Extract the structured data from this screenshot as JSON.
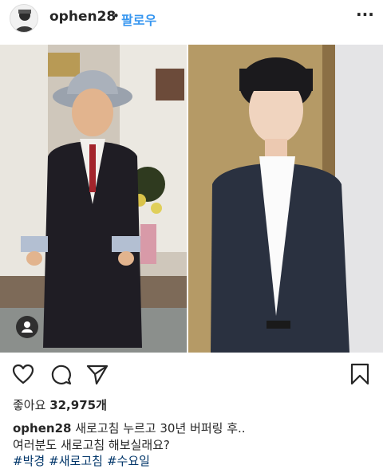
{
  "post": {
    "username": "ophen28",
    "separator": "•",
    "follow_label": "팔로우",
    "more_label": "···"
  },
  "actions": {
    "like_icon": "heart-icon",
    "comment_icon": "comment-icon",
    "share_icon": "paper-plane-icon",
    "save_icon": "bookmark-icon"
  },
  "likes": {
    "label": "좋아요",
    "count": "32,975개"
  },
  "caption": {
    "username": "ophen28",
    "line1": "새로고침 누르고 30년 버퍼링 후..",
    "line2": "여러분도 새로고침 해보실래요?",
    "hashtags": [
      "#박경",
      "#새로고침",
      "#수요일"
    ]
  },
  "colors": {
    "link_blue": "#3897f0",
    "hashtag_blue": "#003569",
    "text": "#262626"
  }
}
